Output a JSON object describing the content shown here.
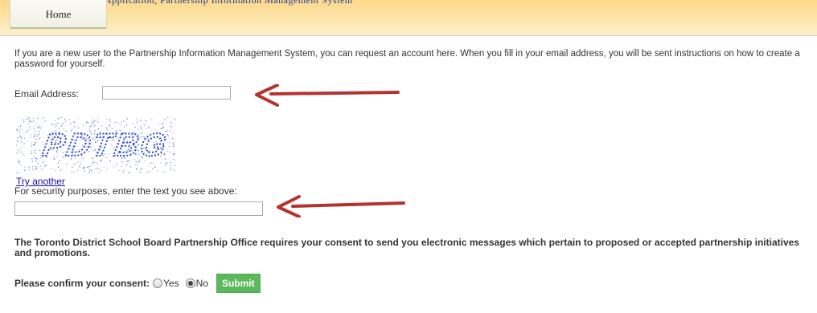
{
  "header": {
    "tabs": [
      {
        "label": "Home"
      }
    ],
    "banner_text_cutoff": "Application, Partnership Information Management System"
  },
  "form": {
    "intro_text": "If you are a new user to the Partnership Information Management System, you can request an account here. When you fill in your email address, you will be sent instructions on how to create a password for yourself.",
    "email_label": "Email Address:",
    "email_value": "",
    "captcha_text": "PDTBG",
    "try_another_label": "Try another",
    "security_label": "For security purposes, enter the text you see above:",
    "captcha_value": "",
    "consent_text": "The Toronto District School Board Partnership Office requires your consent to send you electronic messages which pertain to proposed or accepted partnership initiatives and promotions.",
    "confirm_label": "Please confirm your consent:",
    "options": [
      {
        "label": "Yes",
        "selected": false
      },
      {
        "label": "No",
        "selected": true
      }
    ],
    "submit_label": "Submit"
  },
  "colors": {
    "header_gradient_top": "#fdd98a",
    "annotation_arrow": "#b5332f",
    "submit_button": "#5cb85c",
    "link": "#1a0dab"
  }
}
